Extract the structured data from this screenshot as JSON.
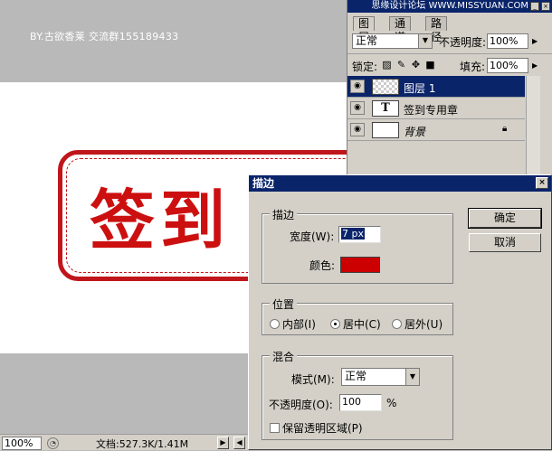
{
  "workspace": {
    "credit": "BY.古欲香莱  交流群155189433",
    "stamp_text": "签到"
  },
  "status_bar": {
    "zoom": "100%",
    "doc_info": "文档:527.3K/1.41M"
  },
  "layers_panel": {
    "watermark": "思缘设计论坛 WWW.MISSYUAN.COM",
    "tabs": [
      "图层",
      "通道",
      "路径"
    ],
    "blend_mode": "正常",
    "opacity_label": "不透明度:",
    "opacity_value": "100%",
    "lock_label": "锁定:",
    "fill_label": "填充:",
    "fill_value": "100%",
    "layers": [
      {
        "name": "图层 1",
        "thumb": "checker",
        "selected": true
      },
      {
        "name": "签到专用章",
        "thumb": "text",
        "thumb_glyph": "T",
        "selected": false
      },
      {
        "name": "背景",
        "thumb": "blank",
        "selected": false,
        "locked": true
      }
    ]
  },
  "stroke_dialog": {
    "title": "描边",
    "close_glyph": "×",
    "ok_label": "确定",
    "cancel_label": "取消",
    "stroke_group": {
      "label": "描边",
      "width_label": "宽度(W):",
      "width_value": "7 px",
      "color_label": "颜色:",
      "color": "#cc0000"
    },
    "position_group": {
      "label": "位置",
      "options": [
        "内部(I)",
        "居中(C)",
        "居外(U)"
      ],
      "selected": "居中(C)"
    },
    "blend_group": {
      "label": "混合",
      "mode_label": "模式(M):",
      "mode_value": "正常",
      "opacity_label": "不透明度(O):",
      "opacity_value": "100",
      "opacity_unit": "%",
      "preserve_label": "保留透明区域(P)"
    }
  },
  "colors": {
    "titlebar": "#0a246a",
    "stamp_red": "#c0161b",
    "panel_gray": "#d4d0c8"
  }
}
